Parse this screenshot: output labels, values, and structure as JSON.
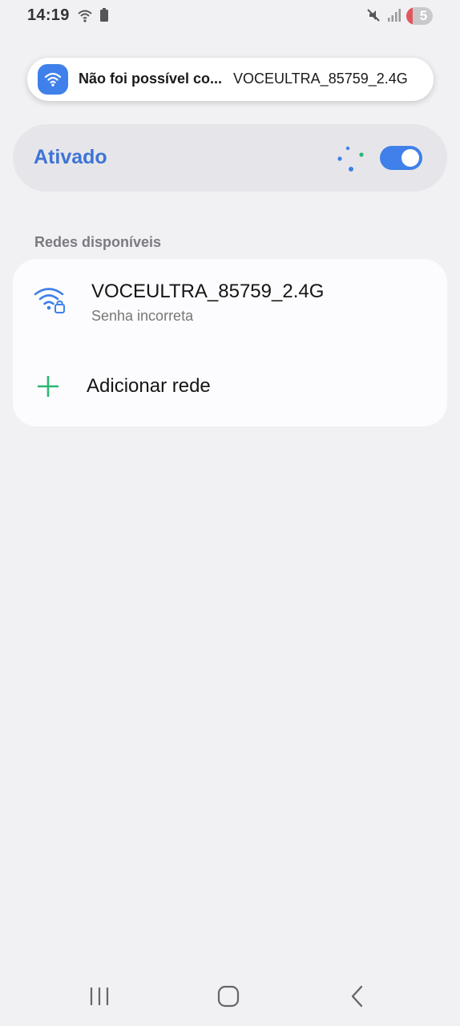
{
  "status_bar": {
    "time": "14:19",
    "icons": [
      "wifi-icon",
      "battery-icon",
      "mute-icon",
      "signal-icon"
    ],
    "notification_count": "5"
  },
  "toast": {
    "icon": "wifi-icon",
    "title": "Não foi possível co...",
    "network": "VOCEULTRA_85759_2.4G"
  },
  "master_switch": {
    "label": "Ativado",
    "enabled": true,
    "scanning_icon": "scanning-dots-icon"
  },
  "available_networks": {
    "header": "Redes disponíveis",
    "items": [
      {
        "name": "VOCEULTRA_85759_2.4G",
        "status": "Senha incorreta",
        "icon": "wifi-lock-icon"
      }
    ],
    "add_network_label": "Adicionar rede"
  },
  "navigation": {
    "buttons": [
      "recents-icon",
      "home-icon",
      "back-icon"
    ]
  },
  "colors": {
    "accent": "#3f80ea",
    "label_blue": "#3e74d6",
    "add_green": "#2bb673",
    "background": "#f1f1f4",
    "card": "#fcfcfe"
  }
}
